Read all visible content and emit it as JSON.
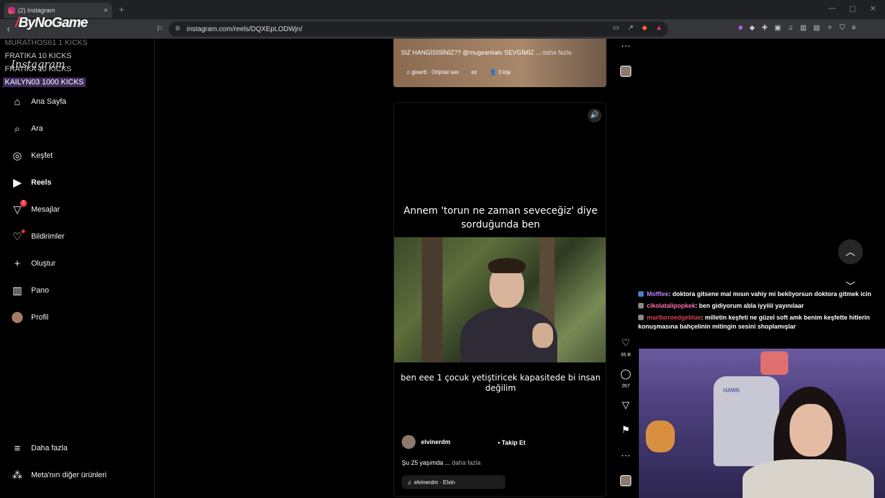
{
  "browser": {
    "tab_title": "(2) Instagram",
    "tab_close": "×",
    "new_tab": "+",
    "url": "instagram.com/reels/DQXEpLODWjn/",
    "window_controls": [
      "—",
      "▢",
      "✕"
    ]
  },
  "overlay": {
    "logo_text": "ByNoGame",
    "kicks": [
      "MURATHOS61  1 KICKS",
      "FRATIKA  10 KICKS",
      "FRATIKA  10 KICKS",
      "KAILYN03  1000 KICKS"
    ],
    "ig_wordmark": "Instagram"
  },
  "sidebar": {
    "items": [
      {
        "label": "Ana Sayfa",
        "icon": "home-icon"
      },
      {
        "label": "Ara",
        "icon": "search-icon"
      },
      {
        "label": "Keşfet",
        "icon": "compass-icon"
      },
      {
        "label": "Reels",
        "icon": "reels-icon"
      },
      {
        "label": "Mesajlar",
        "icon": "messenger-icon",
        "badge": "2"
      },
      {
        "label": "Bildirimler",
        "icon": "heart-icon"
      },
      {
        "label": "Oluştur",
        "icon": "plus-icon"
      },
      {
        "label": "Pano",
        "icon": "dashboard-icon"
      },
      {
        "label": "Profil",
        "icon": "avatar"
      }
    ],
    "bottom": [
      {
        "label": "Daha fazla",
        "icon": "menu-icon"
      },
      {
        "label": "Meta'nın diğer ürünleri",
        "icon": "apps-icon"
      }
    ]
  },
  "previous_reel": {
    "caption": "SIZ HANGİSİSİNİZ?? @mugeanliatv SEVGİMİZ ...",
    "more": "daha fazla",
    "audio": "gisertt · Orijinal ses",
    "extra": "ez",
    "people": "3 kişi"
  },
  "reel": {
    "caption_top": "Annem 'torun ne zaman seveceğiz' diye sorduğunda ben",
    "caption_bottom": "ben eee 1 çocuk yetiştiricek kapasitede bi insan değilim",
    "author": "elvinerdm",
    "follow_sep": "•",
    "follow": "Takip Et",
    "description": "Şu 25 yaşımda ...",
    "more": "daha fazla",
    "audio": "elvinerdm · Elvin"
  },
  "actions": {
    "likes": "35 B",
    "comments": "267"
  },
  "chat": [
    {
      "user": "Mofflee",
      "user_color": "#c080ff",
      "text": ": doktora gitsene mal mısın vahiy mi bekliyorsun doktora gitmek icin"
    },
    {
      "user": "cikolatalipopkek",
      "user_color": "#ff6fb0",
      "text": ": ben gidiyorum abla iyyiiii yayınılaar"
    },
    {
      "user": "marlboroedgeblue",
      "user_color": "#e04050",
      "text": ": milletin keşfeti ne güzel soft amk benim keşfette hitlerin konuşmasına bahçelinin mitingin sesini shoplamışlar"
    }
  ],
  "webcam": {
    "chair_logo": "HAWK"
  }
}
